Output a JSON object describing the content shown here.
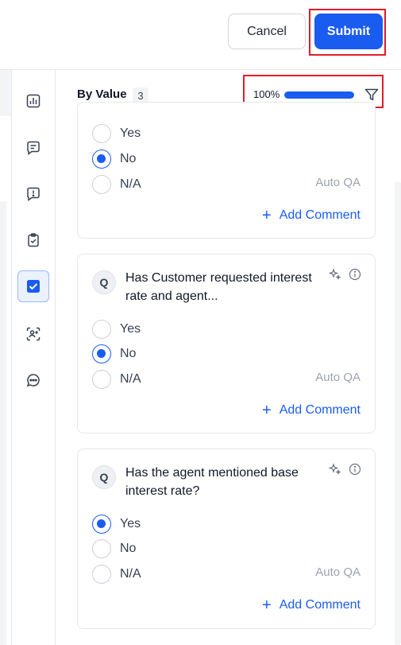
{
  "header": {
    "cancel_label": "Cancel",
    "submit_label": "Submit"
  },
  "rail": {
    "icons": [
      "bar-chart-icon",
      "message-lines-icon",
      "alert-message-icon",
      "clipboard-check-icon",
      "checkbox-icon",
      "face-scan-icon",
      "chat-dots-icon"
    ],
    "active_index": 4
  },
  "toolbar": {
    "title": "By Value",
    "count": "3",
    "progress_label": "100%",
    "progress_value": 100
  },
  "cards": [
    {
      "options": [
        {
          "label": "Yes",
          "selected": false
        },
        {
          "label": "No",
          "selected": true
        },
        {
          "label": "N/A",
          "selected": false
        }
      ],
      "tag": "Auto QA",
      "add_comment": "Add Comment"
    },
    {
      "q_badge": "Q",
      "question": "Has Customer requested interest rate and agent...",
      "options": [
        {
          "label": "Yes",
          "selected": false
        },
        {
          "label": "No",
          "selected": true
        },
        {
          "label": "N/A",
          "selected": false
        }
      ],
      "tag": "Auto QA",
      "add_comment": "Add Comment"
    },
    {
      "q_badge": "Q",
      "question": "Has the agent mentioned base interest rate?",
      "options": [
        {
          "label": "Yes",
          "selected": true
        },
        {
          "label": "No",
          "selected": false
        },
        {
          "label": "N/A",
          "selected": false
        }
      ],
      "tag": "Auto QA",
      "add_comment": "Add Comment"
    }
  ],
  "colors": {
    "accent": "#1a5cf0",
    "highlight": "#e11d2a"
  }
}
